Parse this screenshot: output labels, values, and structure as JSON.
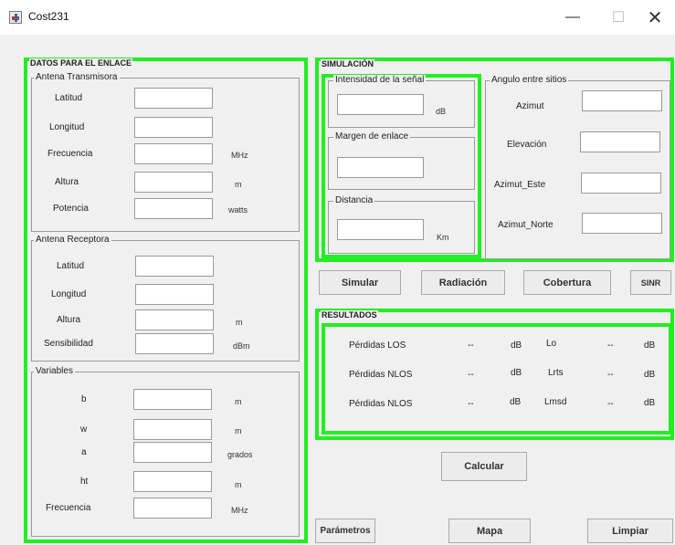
{
  "window": {
    "title": "Cost231",
    "minimize": "—",
    "maximize": "☐",
    "close": "✕"
  },
  "enlace": {
    "title": "DATOS PARA EL ENLACE",
    "tx": {
      "title": "Antena Transmisora",
      "rows": [
        {
          "label": "Latitud",
          "unit": ""
        },
        {
          "label": "Longitud",
          "unit": ""
        },
        {
          "label": "Frecuencia",
          "unit": "MHz"
        },
        {
          "label": "Altura",
          "unit": "m"
        },
        {
          "label": "Potencia",
          "unit": "watts"
        }
      ]
    },
    "rx": {
      "title": "Antena Receptora",
      "rows": [
        {
          "label": "Latitud",
          "unit": ""
        },
        {
          "label": "Longitud",
          "unit": ""
        },
        {
          "label": "Altura",
          "unit": "m"
        },
        {
          "label": "Sensibilidad",
          "unit": "dBm"
        }
      ]
    },
    "vars": {
      "title": "Variables",
      "rows": [
        {
          "label": "b",
          "unit": "m"
        },
        {
          "label": "w",
          "unit": "m"
        },
        {
          "label": "a",
          "unit": "grados"
        },
        {
          "label": "ht",
          "unit": "m"
        },
        {
          "label": "Frecuencia",
          "unit": "MHz"
        }
      ]
    }
  },
  "simulacion": {
    "title": "SIMULACIÓN",
    "intensidad": {
      "title": "Intensidad de la señal",
      "unit": "dB"
    },
    "margen": {
      "title": "Margen de enlace"
    },
    "distancia": {
      "title": "Distancia",
      "unit": "Km"
    },
    "angulo": {
      "title": "Angulo entre sitios",
      "azimut": "Azimut",
      "elevacion": "Elevación",
      "azimut_este": "Azimut_Este",
      "azimut_norte": "Azimut_Norte"
    }
  },
  "buttons": {
    "simular": "Simular",
    "radiacion": "Radiación",
    "cobertura": "Cobertura",
    "sinr": "SINR",
    "calcular": "Calcular",
    "parametros": "Parámetros",
    "mapa": "Mapa",
    "limpiar": "Limpiar"
  },
  "resultados": {
    "title": "RESULTADOS",
    "rows": [
      {
        "label": "Pérdidas LOS",
        "value": "--",
        "unit": "dB",
        "label2": "Lo",
        "value2": "--",
        "unit2": "dB"
      },
      {
        "label": "Pérdidas NLOS",
        "value": "--",
        "unit": "dB",
        "label2": "Lrts",
        "value2": "--",
        "unit2": "dB"
      },
      {
        "label": "Pérdidas NLOS",
        "value": "--",
        "unit": "dB",
        "label2": "Lmsd",
        "value2": "--",
        "unit2": "dB"
      }
    ]
  },
  "colors": {
    "panel_border": "#22ee22",
    "background": "#f0f0f0"
  }
}
